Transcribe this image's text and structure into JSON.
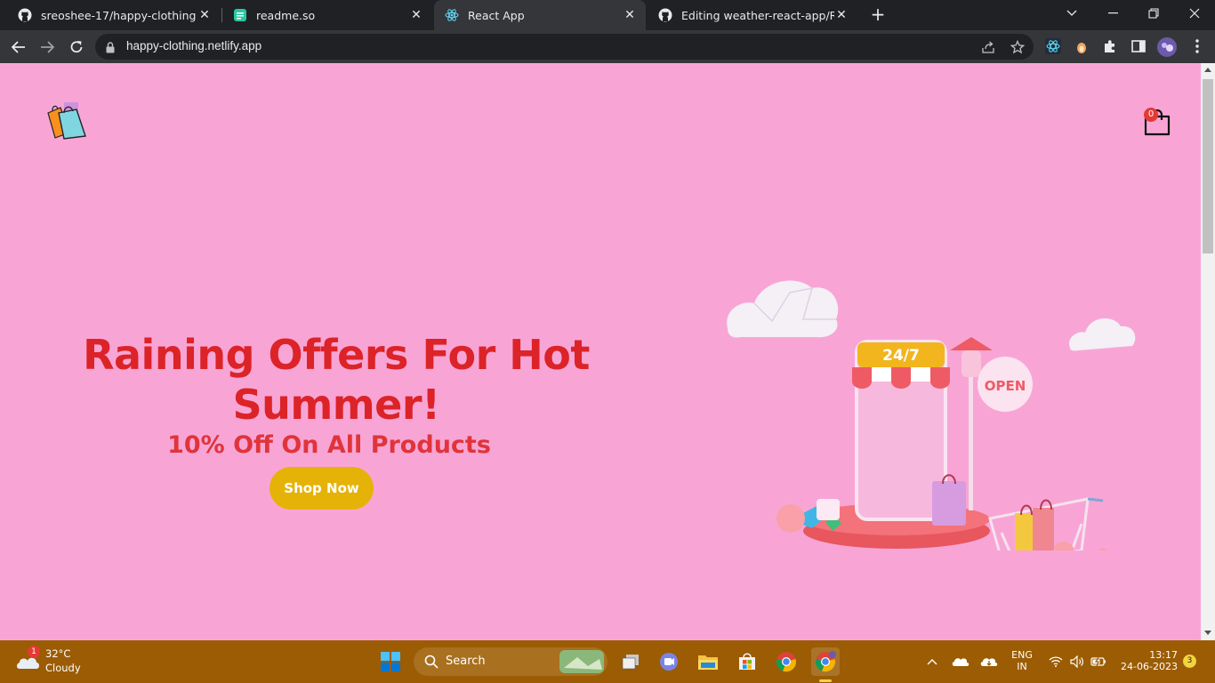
{
  "browser": {
    "tabs": [
      {
        "label": "sreoshee-17/happy-clothing",
        "icon": "github-icon"
      },
      {
        "label": "readme.so",
        "icon": "readme-icon"
      },
      {
        "label": "React App",
        "icon": "react-icon"
      },
      {
        "label": "Editing weather-react-app/READM",
        "icon": "github-icon"
      }
    ],
    "url": "happy-clothing.netlify.app"
  },
  "page": {
    "hero_title": "Raining Offers For Hot Summer!",
    "hero_subtitle": "10% Off On All Products",
    "cta_label": "Shop Now",
    "cart_count": "0",
    "illustration": {
      "sign_24_7": "24/7",
      "sign_open": "OPEN"
    }
  },
  "taskbar": {
    "weather_temp": "32°C",
    "weather_condition": "Cloudy",
    "weather_badge": "1",
    "search_label": "Search",
    "language": "ENG",
    "region": "IN",
    "time": "13:17",
    "date": "24-06-2023",
    "notification_count": "3"
  },
  "colors": {
    "page_background": "#f8a5d6",
    "hero_title": "#dc2327",
    "cta_background": "#e5b307",
    "taskbar": "#9b5c04"
  }
}
